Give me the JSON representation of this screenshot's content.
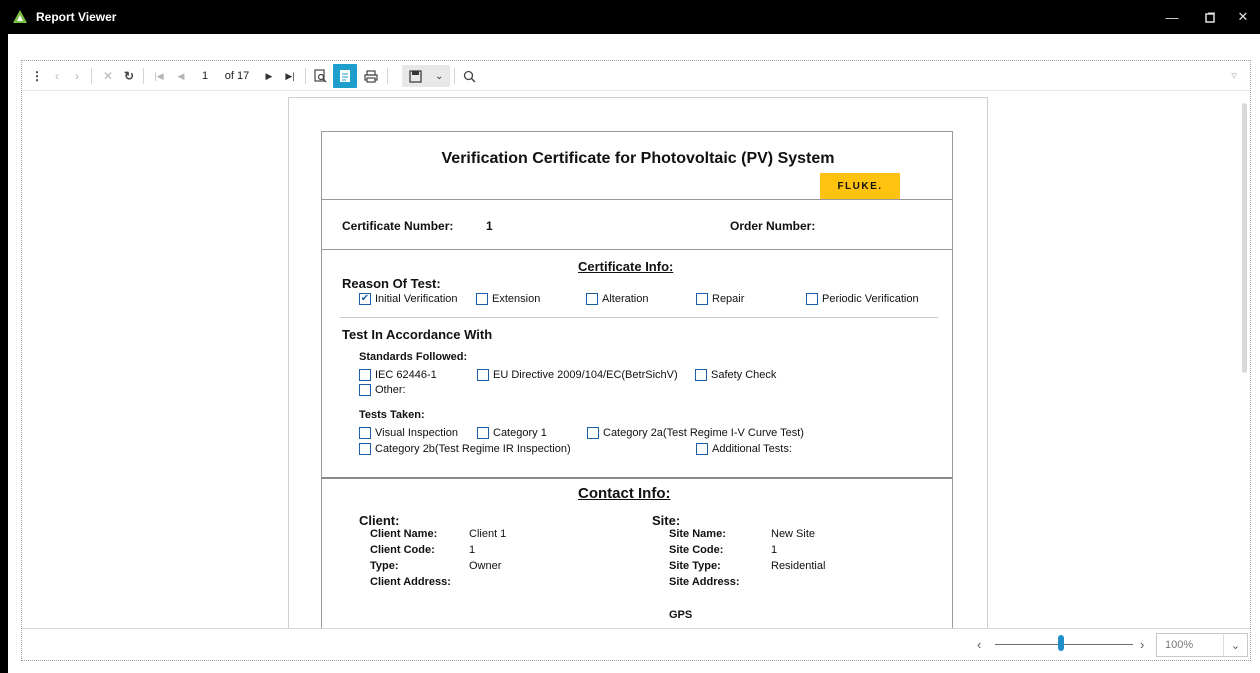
{
  "window": {
    "title": "Report Viewer",
    "minimize_icon": "minimize-icon",
    "restore_icon": "restore-icon",
    "close_icon": "close-icon"
  },
  "toolbar": {
    "current_page": "1",
    "page_count": "of 17",
    "zoom_percent": "100%"
  },
  "report": {
    "title": "Verification Certificate for Photovoltaic (PV) System",
    "logo_text": "FLUKE.",
    "certificate_number_label": "Certificate Number:",
    "certificate_number": "1",
    "order_number_label": "Order Number:",
    "certificate_info_heading": "Certificate Info:",
    "reason_of_test_label": "Reason Of Test:",
    "reasons": {
      "initial": "Initial Verification",
      "extension": "Extension",
      "alteration": "Alteration",
      "repair": "Repair",
      "periodic": "Periodic Verification"
    },
    "initial_checked": "✔",
    "test_in_accordance_label": "Test In Accordance With",
    "standards_followed_label": "Standards Followed:",
    "standards": {
      "iec": "IEC 62446-1",
      "eu": "EU Directive 2009/104/EC(BetrSichV)",
      "safety": "Safety Check",
      "other": "Other:"
    },
    "tests_taken_label": "Tests Taken:",
    "tests": {
      "visual": "Visual Inspection",
      "cat1": "Category 1",
      "cat2a": "Category 2a(Test Regime I-V Curve Test)",
      "cat2b": "Category 2b(Test Regime IR Inspection)",
      "additional": "Additional Tests:"
    },
    "contact_info_heading": "Contact Info:",
    "client": {
      "heading": "Client:",
      "name_label": "Client Name:",
      "name": "Client 1",
      "code_label": "Client Code:",
      "code": "1",
      "type_label": "Type:",
      "type": "Owner",
      "address_label": "Client Address:"
    },
    "site": {
      "heading": "Site:",
      "name_label": "Site Name:",
      "name": "New Site",
      "code_label": "Site Code:",
      "code": "1",
      "type_label": "Site Type:",
      "type": "Residential",
      "address_label": "Site Address:",
      "gps_label": "GPS"
    }
  },
  "colors": {
    "accent": "#1e9ecb",
    "checkbox": "#1a5fa8",
    "logo_bg": "#ffc20e"
  }
}
